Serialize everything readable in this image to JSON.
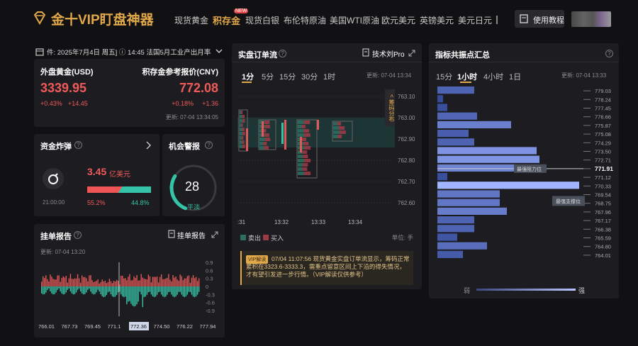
{
  "header": {
    "logo_text": "金十VIP盯盘神器",
    "nav": [
      {
        "label": "现货黄金"
      },
      {
        "label": "积存金",
        "badge": "NEW"
      },
      {
        "label": "现货白银"
      },
      {
        "label": "布伦特原油"
      },
      {
        "label": "美国WTI原油"
      },
      {
        "label": "欧元美元"
      },
      {
        "label": "英镑美元"
      },
      {
        "label": "美元日元"
      }
    ],
    "tutorial_label": "使用教程"
  },
  "ticker": {
    "text": "件: 2025年7月4日 周五] ⓘ 14:45 法国5月工业产出月率("
  },
  "gold_quote": {
    "left_title": "外盘黄金(USD)",
    "left_price": "3339.95",
    "left_pct": "+0.43%",
    "left_chg": "+14.45",
    "right_title": "积存金参考报价(CNY)",
    "right_price": "772.08",
    "right_pct": "+0.18%",
    "right_chg": "+1.36",
    "updated": "更新: 07-04 13:34:05"
  },
  "fund_bomb": {
    "title": "资金炸弹",
    "amount": "3.45",
    "unit": "亿美元",
    "time": "21:00:00",
    "sell_pct": "55.2%",
    "buy_pct": "44.8%",
    "sell_ratio": 0.552
  },
  "opportunity": {
    "title": "机会警报",
    "score": "28",
    "level": "平淡",
    "score_value": 28
  },
  "order_report": {
    "title": "挂单报告",
    "action": "挂单报告",
    "updated": "更新: 07-04 13:20",
    "y_ticks": [
      "0.9",
      "0.6",
      "0.3",
      "0",
      "-0.3",
      "-0.6",
      "-0.9"
    ],
    "x_ticks": [
      "766.01",
      "767.73",
      "769.45",
      "771.1",
      "772.36",
      "774.50",
      "776.22",
      "777.94"
    ],
    "highlight": "772.36"
  },
  "order_flow": {
    "title": "实盘订单流",
    "tech_label": "技术刘Pro",
    "tabs": [
      "1分",
      "5分",
      "15分",
      "30分",
      "1时"
    ],
    "active_tab": "1分",
    "updated": "更新: 07-04 13:34",
    "y_ticks": [
      "763.10",
      "763.00",
      "762.90",
      "762.80",
      "762.70",
      "762.60"
    ],
    "x_ticks": [
      ":31",
      "13:32",
      "13:33",
      "13:34"
    ],
    "chip_label": "< 筹码分布",
    "legend_sell": "卖出",
    "legend_buy": "买入",
    "unit": "单位: 手",
    "vip_badge": "VIP解读",
    "vip_text": "07/04 11:07:56 现货黄金实盘订单流显示，筹码正常累积在3323.6-3333.3，需重点留意区间上下沿的得失情况，才有望引发进一步行情。（VIP解读仅供参考）"
  },
  "resonance": {
    "title": "指标共振点汇总",
    "tabs": [
      "15分",
      "1小时",
      "4小时",
      "1日"
    ],
    "active_tab": "1小时",
    "updated": "更新: 07-04 13:33",
    "levels": [
      "779.03",
      "778.24",
      "777.45",
      "776.66",
      "775.87",
      "775.08",
      "774.29",
      "773.50",
      "772.71",
      "771.91",
      "771.12",
      "770.33",
      "769.54",
      "768.75",
      "767.96",
      "767.17",
      "766.38",
      "765.59",
      "764.80",
      "764.01"
    ],
    "current": "771.91",
    "resistance_label": "最强阻力位",
    "support_label": "最强支撑位",
    "weak_label": "弱",
    "strong_label": "强",
    "bar_strengths": [
      0.26,
      0.04,
      0.07,
      0.28,
      0.52,
      0.22,
      0.26,
      0.7,
      0.72,
      0.55,
      0.07,
      1.0,
      0.44,
      0.44,
      0.49,
      0.26,
      0.26,
      0.14,
      0.35,
      0.18
    ]
  }
}
